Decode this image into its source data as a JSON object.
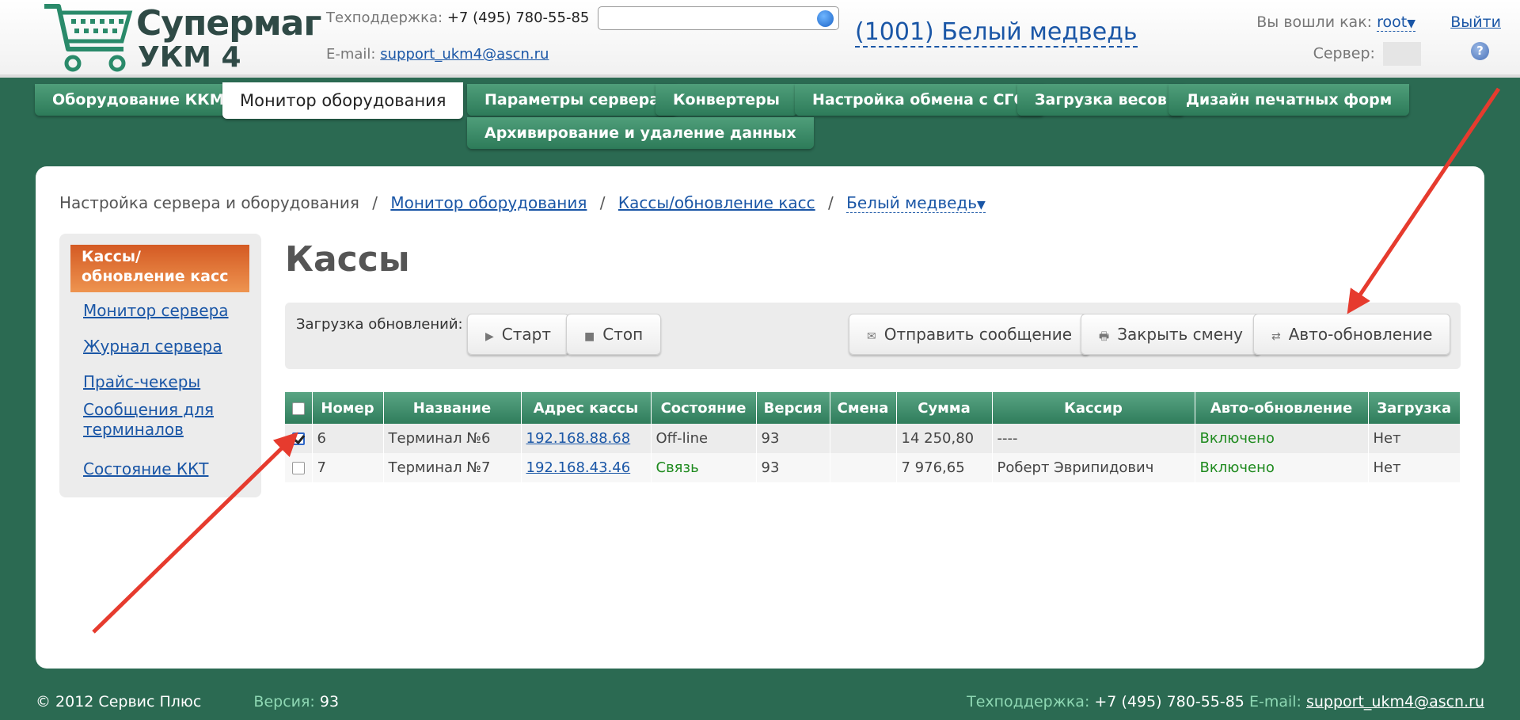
{
  "header": {
    "logo_line1": "Супермаг",
    "logo_line2": "УКМ 4",
    "support_label": "Техподдержка:",
    "support_phone": "+7 (495) 780-55-85",
    "email_label": "E-mail:",
    "support_email": "support_ukm4@ascn.ru",
    "search_placeholder": "",
    "store_name": "(1001) Белый медведь",
    "login_label": "Вы вошли как:",
    "login_user": "root",
    "logout": "Выйти",
    "server_label": "Сервер:",
    "help": "?"
  },
  "nav": {
    "tabs": [
      "Оборудование ККМ",
      "Монитор оборудования",
      "Параметры сервера",
      "Конвертеры",
      "Настройка обмена с СГО",
      "Загрузка весов",
      "Дизайн печатных форм",
      "Архивирование и удаление данных"
    ],
    "active_tab": "Монитор оборудования"
  },
  "breadcrumb": {
    "root": "Настройка сервера и оборудования",
    "level1": "Монитор оборудования",
    "level2": "Кассы/обновление касс",
    "current": "Белый медведь"
  },
  "sidebar": {
    "active": "Кассы/обновление касс",
    "items": [
      "Монитор сервера",
      "Журнал сервера",
      "Прайс-чекеры",
      "Сообщения для терминалов",
      "Состояние ККТ"
    ]
  },
  "main": {
    "title": "Кассы",
    "toolbar": {
      "label": "Загрузка обновлений:",
      "start": "Старт",
      "stop": "Стоп",
      "send_message": "Отправить сообщение",
      "close_shift": "Закрыть смену",
      "auto_update": "Авто-обновление"
    },
    "table": {
      "columns": [
        "Номер",
        "Название",
        "Адрес кассы",
        "Состояние",
        "Версия",
        "Смена",
        "Сумма",
        "Кассир",
        "Авто-обновление",
        "Загрузка"
      ],
      "rows": [
        {
          "checked": true,
          "number": "6",
          "name": "Терминал №6",
          "address": "192.168.88.68",
          "state": "Off-line",
          "version": "93",
          "shift": "",
          "sum": "14 250,80",
          "cashier": "----",
          "auto": "Включено",
          "load": "Нет"
        },
        {
          "checked": false,
          "number": "7",
          "name": "Терминал №7",
          "address": "192.168.43.46",
          "state": "Связь",
          "version": "93",
          "shift": "",
          "sum": "7 976,65",
          "cashier": "Роберт Эврипидович",
          "auto": "Включено",
          "load": "Нет"
        }
      ]
    }
  },
  "footer": {
    "copyright": "© 2012 Сервис Плюс",
    "version_label": "Версия:",
    "version": "93",
    "support_label": "Техподдержка:",
    "support_phone": "+7 (495) 780-55-85",
    "email_label": "E-mail:",
    "email": "support_ukm4@ascn.ru"
  },
  "colors": {
    "background": "#2b6a52",
    "tab": "#2d7b59",
    "sidebar_active": "#d45a23",
    "link": "#1a56a6",
    "status_ok": "#1e8a1e",
    "annotation_arrow": "#e63b2e"
  }
}
